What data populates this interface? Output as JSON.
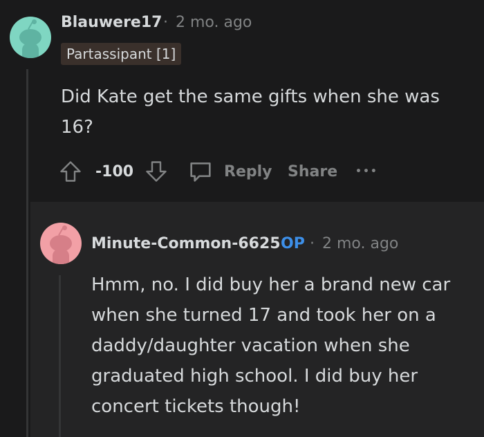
{
  "comment": {
    "author": "Blauwere17",
    "separator": "·",
    "time": "2 mo. ago",
    "flair": "Partassipant [1]",
    "body": "Did Kate get the same gifts when she was 16?",
    "score": "-100",
    "reply_label": "Reply",
    "share_label": "Share",
    "more_label": "•••"
  },
  "reply": {
    "author": "Minute-Common-6625",
    "op_badge": "OP",
    "separator": "·",
    "time": "2 mo. ago",
    "body": "Hmm, no. I did buy her a brand new car when she turned 17 and took her on a daddy/daughter vacation when she graduated high school. I did buy her concert tickets though!"
  },
  "colors": {
    "background": "#1a1a1b",
    "reply_panel": "#242425",
    "op_badge": "#3d8fe8",
    "avatar_1": "#7fd6c2",
    "avatar_2": "#f2a0a6",
    "flair_bg": "#3a302b"
  },
  "icons": {
    "upvote": "arrow-up-icon",
    "downvote": "arrow-down-icon",
    "reply": "speech-bubble-icon",
    "more": "ellipsis-icon",
    "avatar": "snoo-avatar-icon"
  }
}
